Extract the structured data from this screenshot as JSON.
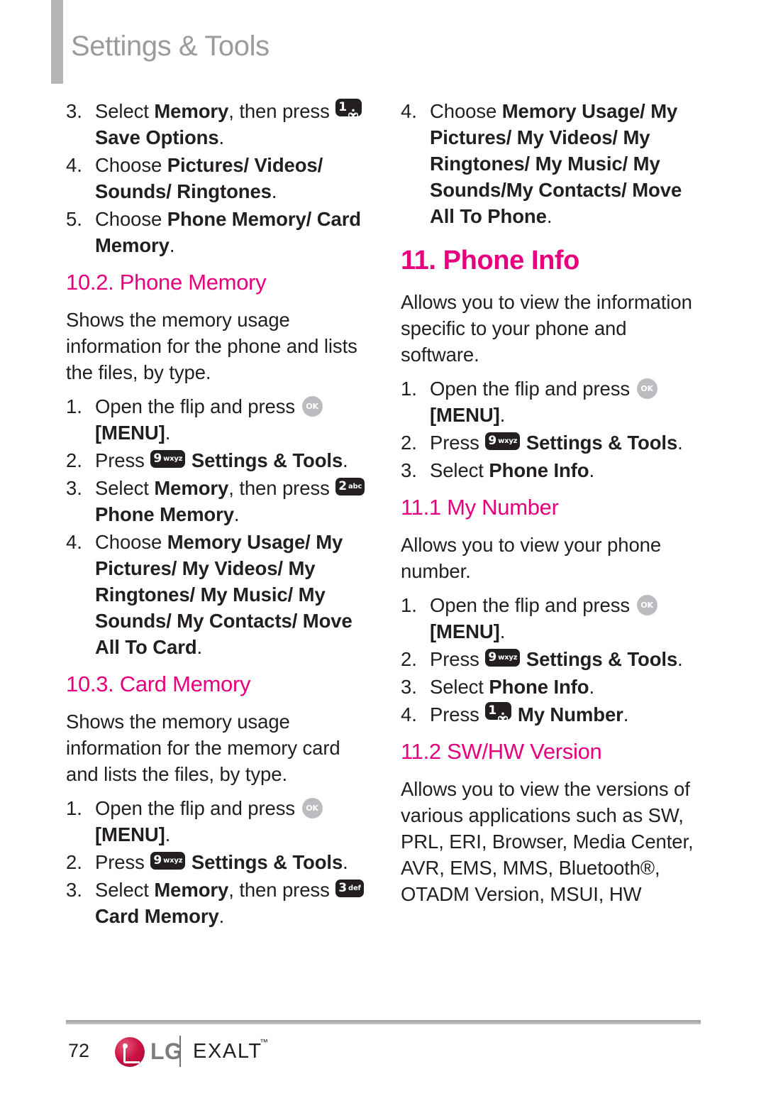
{
  "header": {
    "title": "Settings & Tools"
  },
  "keys": {
    "one": {
      "digit": "1",
      "letters": "",
      "icon": "voicemail-icon"
    },
    "two": {
      "digit": "2",
      "letters": "abc"
    },
    "three": {
      "digit": "3",
      "letters": "def"
    },
    "nine": {
      "digit": "9",
      "letters": "wxyz"
    },
    "ok": {
      "label": "OK"
    }
  },
  "colors": {
    "accent_magenta": "#e6007e",
    "header_gray": "#9a9a9f",
    "header_bar_gray": "#b4b4b9",
    "body_text": "#231f20",
    "key_dark": "#231f20",
    "ok_gray": "#bcbcc0",
    "lg_red": "#cc1144",
    "lg_wordmark_gray": "#7b7d81"
  },
  "left_column": {
    "continued_steps": [
      {
        "num": "3.",
        "pre": "Select ",
        "bold1": "Memory",
        "mid": ", then press ",
        "key": "one",
        "bold2": "Save Options",
        "post": "."
      },
      {
        "num": "4.",
        "pre": "Choose ",
        "bold1": "Pictures/ Videos/ Sounds/ Ringtones",
        "post": "."
      },
      {
        "num": "5.",
        "pre": "Choose ",
        "bold1": "Phone Memory/ Card Memory",
        "post": "."
      }
    ],
    "section_phone_memory": {
      "heading": "10.2. Phone Memory",
      "description": "Shows the memory usage information for the phone and lists the files, by type.",
      "steps": [
        {
          "num": "1.",
          "pre": "Open the flip and press ",
          "key": "ok",
          "bold2": "[MENU]",
          "post": "."
        },
        {
          "num": "2.",
          "pre": "Press ",
          "key": "nine",
          "bold2": "Settings & Tools",
          "post": "."
        },
        {
          "num": "3.",
          "pre": "Select ",
          "bold1": "Memory",
          "mid": ", then press ",
          "key": "two",
          "bold2": "Phone Memory",
          "post": "."
        },
        {
          "num": "4.",
          "pre": "Choose ",
          "bold1": "Memory Usage/ My Pictures/ My Videos/ My Ringtones/ My Music/ My Sounds/ My Contacts/ Move All To Card",
          "post": "."
        }
      ]
    },
    "section_card_memory": {
      "heading": "10.3. Card Memory",
      "description": "Shows the memory usage information for the memory card and lists the files, by type.",
      "steps": [
        {
          "num": "1.",
          "pre": "Open the flip and press ",
          "key": "ok",
          "bold2": "[MENU]",
          "post": "."
        },
        {
          "num": "2.",
          "pre": "Press ",
          "key": "nine",
          "bold2": "Settings & Tools",
          "post": "."
        },
        {
          "num": "3.",
          "pre": "Select ",
          "bold1": "Memory",
          "mid": ", then press ",
          "key": "three",
          "bold2": "Card Memory",
          "post": "."
        }
      ]
    }
  },
  "right_column": {
    "continued_step": {
      "num": "4.",
      "pre": "Choose ",
      "bold1": "Memory Usage/ My Pictures/ My Videos/ My Ringtones/ My Music/ My Sounds/My Contacts/ Move All To Phone",
      "post": "."
    },
    "section_phone_info": {
      "heading": "11. Phone Info",
      "description": "Allows you to view the information specific to your phone and software.",
      "steps": [
        {
          "num": "1.",
          "pre": "Open the flip and press ",
          "key": "ok",
          "bold2": "[MENU]",
          "post": "."
        },
        {
          "num": "2.",
          "pre": "Press ",
          "key": "nine",
          "bold2": "Settings & Tools",
          "post": "."
        },
        {
          "num": "3.",
          "pre": "Select ",
          "bold2": "Phone Info",
          "post": "."
        }
      ]
    },
    "section_my_number": {
      "heading": "11.1 My Number",
      "description": "Allows you to view your phone number.",
      "steps": [
        {
          "num": "1.",
          "pre": "Open the flip and press ",
          "key": "ok",
          "bold2": "[MENU]",
          "post": "."
        },
        {
          "num": "2.",
          "pre": "Press ",
          "key": "nine",
          "bold2": "Settings & Tools",
          "post": "."
        },
        {
          "num": "3.",
          "pre": "Select ",
          "bold2": "Phone Info",
          "post": "."
        },
        {
          "num": "4.",
          "pre": "Press ",
          "key": "one",
          "bold2": "My Number",
          "post": "."
        }
      ]
    },
    "section_sw_hw": {
      "heading": "11.2 SW/HW Version",
      "description": "Allows you to view the versions of various applications such as SW, PRL, ERI, Browser, Media Center, AVR, EMS, MMS, Bluetooth®, OTADM Version, MSUI, HW"
    }
  },
  "footer": {
    "page_number": "72",
    "brand": "LG",
    "product": "EXALT",
    "trademark": "™"
  }
}
